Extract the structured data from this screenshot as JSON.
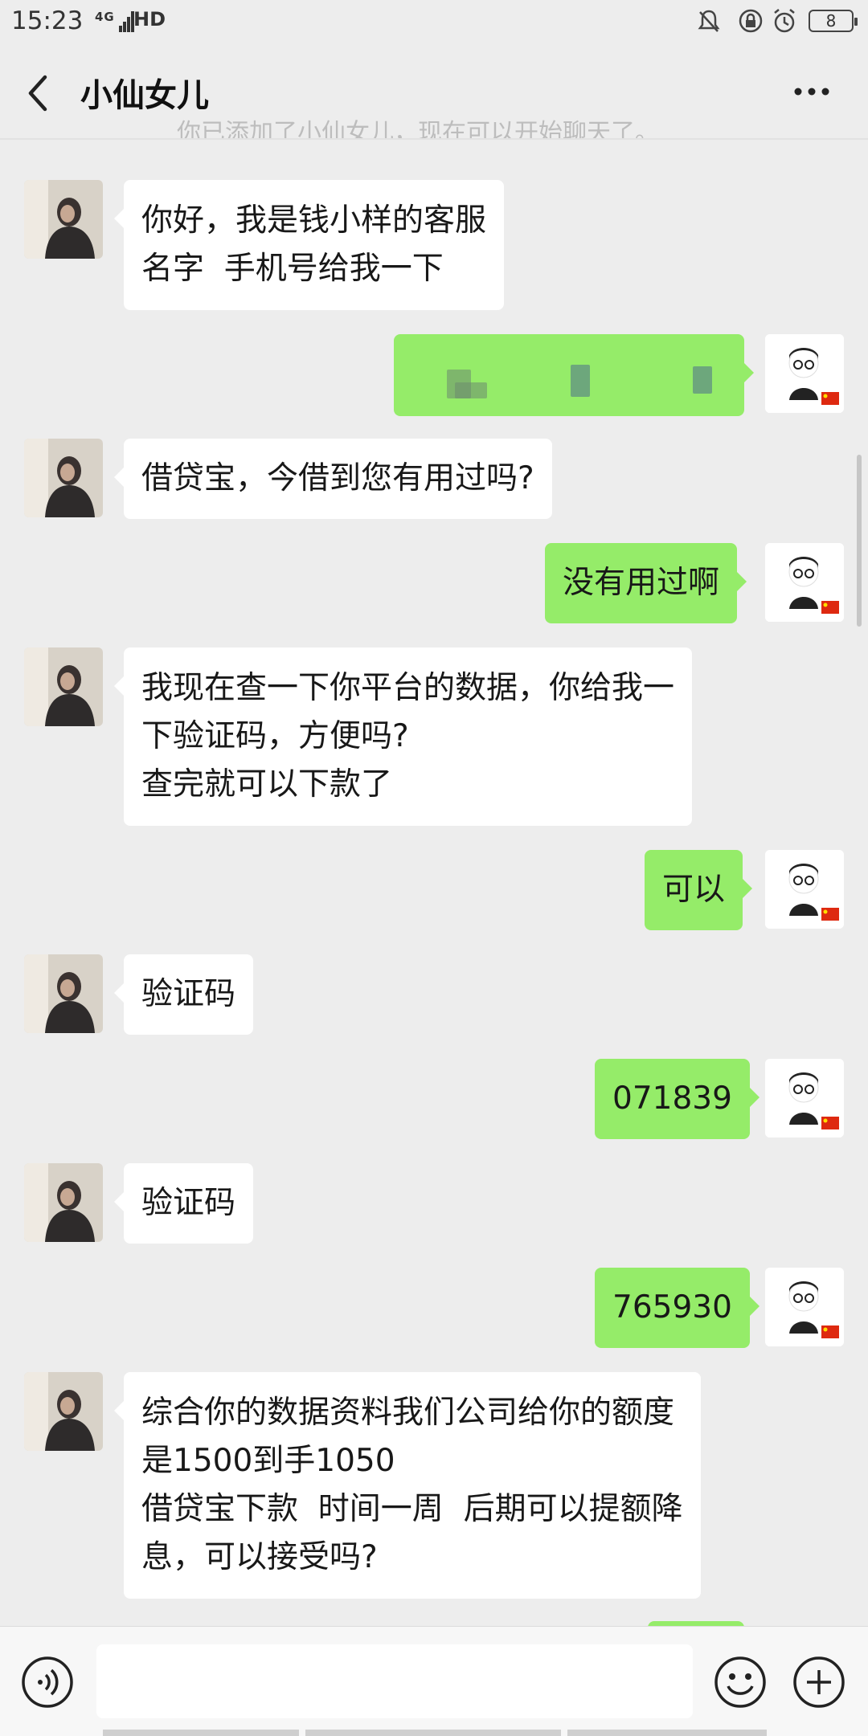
{
  "status_bar": {
    "time": "15:23",
    "network": "4G",
    "hd": "HD",
    "battery": "8"
  },
  "header": {
    "title": "小仙女儿"
  },
  "system_notice": "你已添加了小仙女儿，现在可以开始聊天了。",
  "messages": [
    {
      "from": "peer",
      "text": "你好，我是钱小样的客服\n名字  手机号给我一下"
    },
    {
      "from": "self",
      "text": ""
    },
    {
      "from": "peer",
      "text": "借贷宝，今借到您有用过吗?"
    },
    {
      "from": "self",
      "text": "没有用过啊"
    },
    {
      "from": "peer",
      "text": "我现在查一下你平台的数据，你给我一\n下验证码，方便吗?\n查完就可以下款了"
    },
    {
      "from": "self",
      "text": "可以"
    },
    {
      "from": "peer",
      "text": "验证码"
    },
    {
      "from": "self",
      "text": "071839"
    },
    {
      "from": "peer",
      "text": "验证码"
    },
    {
      "from": "self",
      "text": "765930"
    },
    {
      "from": "peer",
      "text": "综合你的数据资料我们公司给你的额度\n是1500到手1050\n借贷宝下款  时间一周  后期可以提额降\n息，可以接受吗?"
    }
  ],
  "input": {
    "value": ""
  },
  "colors": {
    "background": "#ededed",
    "self_bubble": "#95ec69",
    "peer_bubble": "#ffffff"
  },
  "icons": [
    "back-arrow-icon",
    "more-icon",
    "voice-icon",
    "emoji-icon",
    "plus-icon"
  ]
}
